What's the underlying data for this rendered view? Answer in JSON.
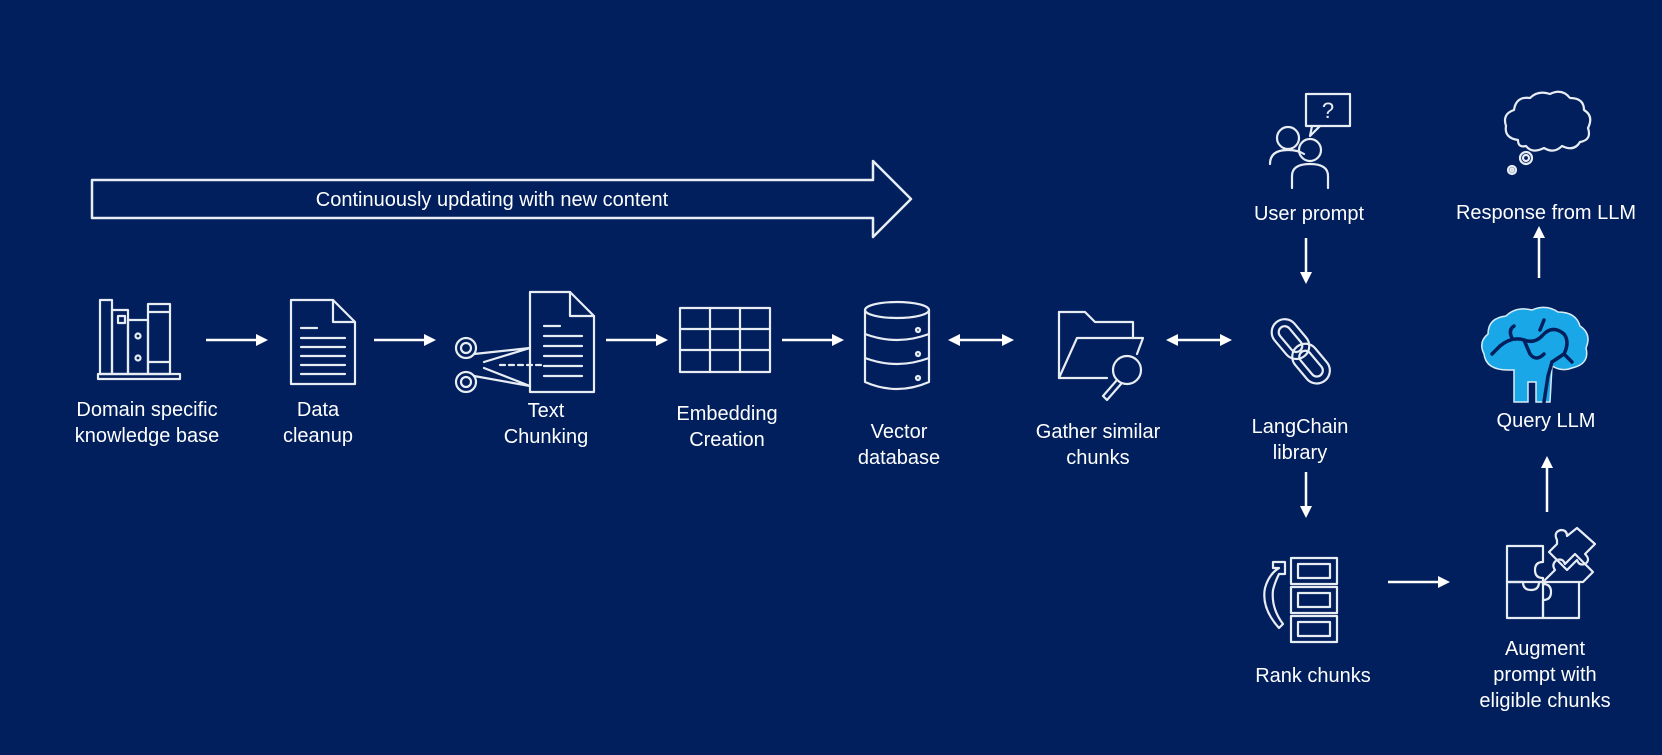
{
  "background_color": "#001f5c",
  "accent_color": "#1aa7e8",
  "banner": {
    "text": "Continuously updating with new content",
    "icon": "right-block-arrow"
  },
  "steps": {
    "knowledge_base": {
      "label_line1": "Domain specific",
      "label_line2": "knowledge base",
      "icon": "bookshelf-icon"
    },
    "data_cleanup": {
      "label_line1": "Data",
      "label_line2": "cleanup",
      "icon": "document-icon"
    },
    "text_chunking": {
      "label_line1": "Text",
      "label_line2": "Chunking",
      "icon": "scissors-document-icon"
    },
    "embedding_creation": {
      "label_line1": "Embedding",
      "label_line2": "Creation",
      "icon": "grid-table-icon"
    },
    "vector_database": {
      "label_line1": "Vector",
      "label_line2": "database",
      "icon": "database-icon"
    },
    "gather_similar": {
      "label_line1": "Gather similar",
      "label_line2": "chunks",
      "icon": "folder-search-icon"
    },
    "langchain": {
      "label_line1": "LangChain",
      "label_line2": "library",
      "icon": "chain-link-icon"
    },
    "user_prompt": {
      "label": "User prompt",
      "icon": "users-question-icon"
    },
    "rank_chunks": {
      "label": "Rank chunks",
      "icon": "rank-list-icon"
    },
    "augment_prompt": {
      "label_line1": "Augment",
      "label_line2": "prompt with",
      "label_line3": "eligible chunks",
      "icon": "puzzle-icon"
    },
    "query_llm": {
      "label": "Query LLM",
      "icon": "brain-icon"
    },
    "response": {
      "label": "Response from LLM",
      "icon": "thought-cloud-icon"
    }
  },
  "connectors": [
    {
      "from": "knowledge_base",
      "to": "data_cleanup",
      "direction": "right"
    },
    {
      "from": "data_cleanup",
      "to": "text_chunking",
      "direction": "right"
    },
    {
      "from": "text_chunking",
      "to": "embedding_creation",
      "direction": "right"
    },
    {
      "from": "embedding_creation",
      "to": "vector_database",
      "direction": "right"
    },
    {
      "from": "vector_database",
      "to": "gather_similar",
      "direction": "both"
    },
    {
      "from": "gather_similar",
      "to": "langchain",
      "direction": "both"
    },
    {
      "from": "user_prompt",
      "to": "langchain",
      "direction": "down"
    },
    {
      "from": "langchain",
      "to": "rank_chunks",
      "direction": "down"
    },
    {
      "from": "rank_chunks",
      "to": "augment_prompt",
      "direction": "right"
    },
    {
      "from": "augment_prompt",
      "to": "query_llm",
      "direction": "up"
    },
    {
      "from": "query_llm",
      "to": "response",
      "direction": "up"
    }
  ]
}
